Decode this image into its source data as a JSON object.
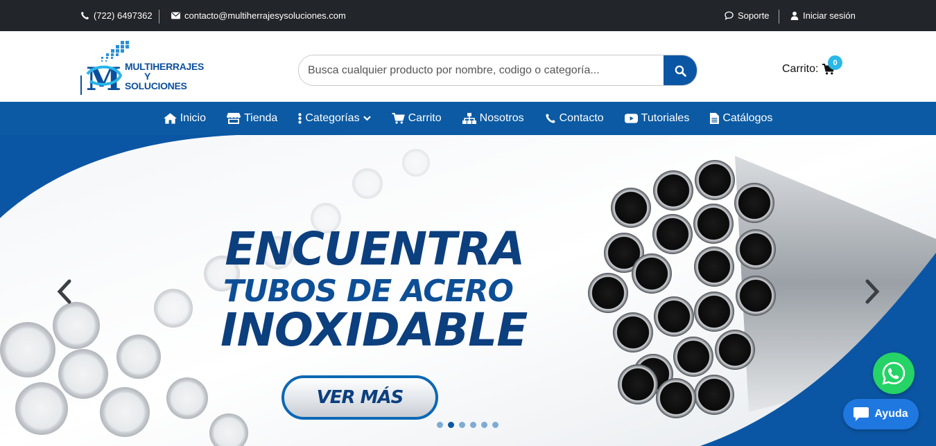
{
  "topbar": {
    "phone": "(722) 6497362",
    "email": "contacto@multiherrajesysoluciones.com",
    "support": "Soporte",
    "login": "Iniciar sesión"
  },
  "header": {
    "logo_line1": "MULTIHERRAJES",
    "logo_line2": "Y",
    "logo_line3": "SOLUCIONES",
    "search_placeholder": "Busca cualquier producto por nombre, codigo o categoría...",
    "cart_label": "Carrito:",
    "cart_count": "0"
  },
  "nav": {
    "items": [
      {
        "label": "Inicio",
        "icon": "home-icon"
      },
      {
        "label": "Tienda",
        "icon": "store-icon"
      },
      {
        "label": "Categorías",
        "icon": "vertical-dots-icon"
      },
      {
        "label": "Carrito",
        "icon": "cart-icon"
      },
      {
        "label": "Nosotros",
        "icon": "sitemap-icon"
      },
      {
        "label": "Contacto",
        "icon": "phone-icon"
      },
      {
        "label": "Tutoriales",
        "icon": "youtube-icon"
      },
      {
        "label": "Catálogos",
        "icon": "document-icon"
      }
    ]
  },
  "hero": {
    "line1": "ENCUENTRA",
    "line2": "TUBOS DE ACERO",
    "line3": "INOXIDABLE",
    "cta": "VER MÁS",
    "slide_count": 6,
    "active_slide": 2
  },
  "widgets": {
    "help": "Ayuda"
  },
  "colors": {
    "topbar": "#222529",
    "brand_blue": "#0b5aa3",
    "cart_badge": "#2bb8e8",
    "whatsapp": "#25d366",
    "help": "#1f78e0"
  }
}
